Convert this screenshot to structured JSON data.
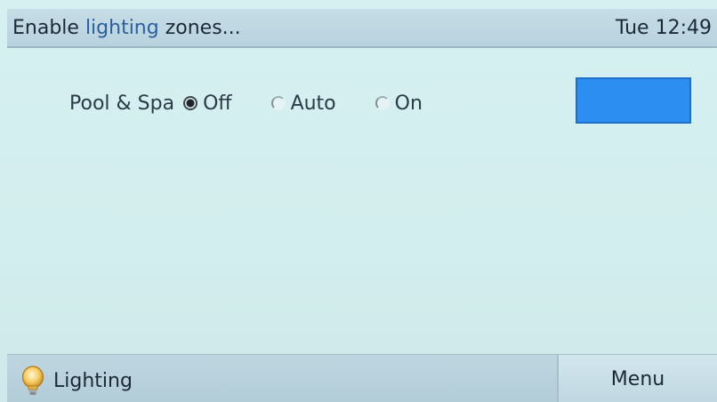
{
  "header": {
    "title_prefix": "Enable ",
    "title_accent": "lighting",
    "title_suffix": " zones...",
    "clock": "Tue 12:49"
  },
  "zones": [
    {
      "name": "Pool & Spa",
      "options": [
        {
          "label": "Off",
          "selected": true
        },
        {
          "label": "Auto",
          "selected": false
        },
        {
          "label": "On",
          "selected": false
        }
      ],
      "color": "#2d8ef2"
    }
  ],
  "footer": {
    "section_label": "Lighting",
    "section_icon": "lightbulb-icon",
    "menu_label": "Menu"
  }
}
